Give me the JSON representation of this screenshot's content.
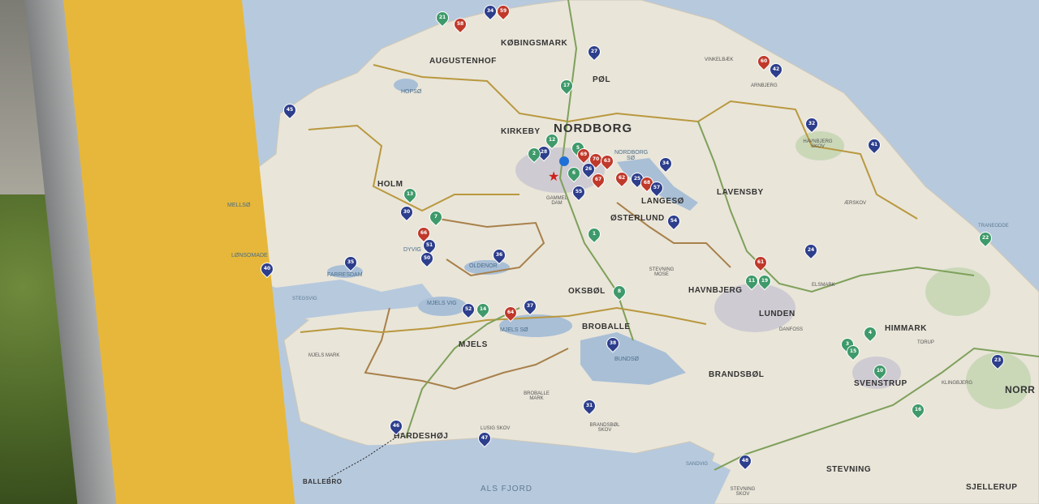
{
  "towns_major": [
    {
      "id": "nordborg",
      "label": "NORDBORG"
    }
  ],
  "towns": [
    {
      "id": "kobingsmark",
      "label": "KØBINGSMARK"
    },
    {
      "id": "augustenhof",
      "label": "AUGUSTENHOF"
    },
    {
      "id": "pol",
      "label": "PØL"
    },
    {
      "id": "kirkeby",
      "label": "KIRKEBY"
    },
    {
      "id": "holm",
      "label": "HOLM"
    },
    {
      "id": "langeso",
      "label": "LANGESØ"
    },
    {
      "id": "osterlund",
      "label": "ØSTERLUND"
    },
    {
      "id": "lavensby",
      "label": "LAVENSBY"
    },
    {
      "id": "havnbjerg",
      "label": "HAVNBJERG"
    },
    {
      "id": "oksbol",
      "label": "OKSBØL"
    },
    {
      "id": "lunden",
      "label": "LUNDEN"
    },
    {
      "id": "himmark",
      "label": "HIMMARK"
    },
    {
      "id": "broballe",
      "label": "BROBALLE"
    },
    {
      "id": "mjels",
      "label": "MJELS"
    },
    {
      "id": "brandsbol",
      "label": "BRANDSBØL"
    },
    {
      "id": "svenstrup",
      "label": "SVENSTRUP"
    },
    {
      "id": "hardeshoj",
      "label": "HARDESHØJ"
    },
    {
      "id": "stevning",
      "label": "STEVNING"
    },
    {
      "id": "sjellerup",
      "label": "SJELLERUP"
    },
    {
      "id": "norr",
      "label": "NORR"
    }
  ],
  "places_small": [
    {
      "id": "vinkelbaek",
      "label": "VINKELBÆK"
    },
    {
      "id": "arnbjerg",
      "label": "ARNBJERG"
    },
    {
      "id": "havnbjerg-skov",
      "label": "HAVNBJERG SKOV"
    },
    {
      "id": "aerskov",
      "label": "ÆRSKOV"
    },
    {
      "id": "gammel-dam",
      "label": "GAMMEL DAM"
    },
    {
      "id": "stevning-mose",
      "label": "STEVNING MOSE"
    },
    {
      "id": "elsmark",
      "label": "ELSMARK"
    },
    {
      "id": "danfoss",
      "label": "DANFOSS"
    },
    {
      "id": "torup",
      "label": "TORUP"
    },
    {
      "id": "klingbjerg",
      "label": "KLINGBJERG"
    },
    {
      "id": "mjels-mark",
      "label": "MJELS MARK"
    },
    {
      "id": "broballe-mark",
      "label": "BROBALLE MARK"
    },
    {
      "id": "brandsbol-skov",
      "label": "BRANDSBØL SKOV"
    },
    {
      "id": "lusig-skov",
      "label": "LUSIG SKOV"
    },
    {
      "id": "stevning-skov",
      "label": "STEVNING SKOV"
    },
    {
      "id": "ballebro",
      "label": "BALLEBRO"
    }
  ],
  "waters": [
    {
      "id": "hopso",
      "label": "HOPSØ"
    },
    {
      "id": "nordborg-so",
      "label": "NORDBORG SØ"
    },
    {
      "id": "mellso",
      "label": "MELLSØ"
    },
    {
      "id": "lonsomade",
      "label": "LØNSOMADE"
    },
    {
      "id": "farresdam",
      "label": "FARRESDAM"
    },
    {
      "id": "dyvig",
      "label": "DYVIG"
    },
    {
      "id": "oldenor",
      "label": "OLDENOR"
    },
    {
      "id": "mjels-vig",
      "label": "MJELS VIG"
    },
    {
      "id": "mjels-so",
      "label": "MJELS SØ"
    },
    {
      "id": "bundso",
      "label": "BUNDSØ"
    },
    {
      "id": "stegsvig",
      "label": "STEGSVIG"
    },
    {
      "id": "sandvig",
      "label": "SANDVIG"
    },
    {
      "id": "tranedde",
      "label": "TRANEODDE"
    }
  ],
  "sea_label": "ALS FJORD",
  "marker_colors": {
    "blue": "#2d3e8c",
    "red": "#c0392b",
    "green": "#3e9a6a"
  },
  "markers": [
    {
      "n": "21",
      "c": "green"
    },
    {
      "n": "58",
      "c": "red"
    },
    {
      "n": "34",
      "c": "blue"
    },
    {
      "n": "59",
      "c": "red"
    },
    {
      "n": "27",
      "c": "blue"
    },
    {
      "n": "17",
      "c": "green"
    },
    {
      "n": "60",
      "c": "red"
    },
    {
      "n": "42",
      "c": "blue"
    },
    {
      "n": "45",
      "c": "blue"
    },
    {
      "n": "32",
      "c": "blue"
    },
    {
      "n": "41",
      "c": "blue"
    },
    {
      "n": "12",
      "c": "green"
    },
    {
      "n": "28",
      "c": "blue"
    },
    {
      "n": "2",
      "c": "green"
    },
    {
      "n": "5",
      "c": "green"
    },
    {
      "n": "69",
      "c": "red"
    },
    {
      "n": "70",
      "c": "red"
    },
    {
      "n": "63",
      "c": "red"
    },
    {
      "n": "26",
      "c": "blue"
    },
    {
      "n": "6",
      "c": "green"
    },
    {
      "n": "67",
      "c": "red"
    },
    {
      "n": "62",
      "c": "red"
    },
    {
      "n": "25",
      "c": "blue"
    },
    {
      "n": "68",
      "c": "red"
    },
    {
      "n": "57",
      "c": "blue"
    },
    {
      "n": "34",
      "c": "blue"
    },
    {
      "n": "55",
      "c": "blue"
    },
    {
      "n": "13",
      "c": "green"
    },
    {
      "n": "30",
      "c": "blue"
    },
    {
      "n": "7",
      "c": "green"
    },
    {
      "n": "54",
      "c": "blue"
    },
    {
      "n": "1",
      "c": "green"
    },
    {
      "n": "66",
      "c": "red"
    },
    {
      "n": "51",
      "c": "blue"
    },
    {
      "n": "50",
      "c": "blue"
    },
    {
      "n": "36",
      "c": "blue"
    },
    {
      "n": "35",
      "c": "blue"
    },
    {
      "n": "40",
      "c": "blue"
    },
    {
      "n": "22",
      "c": "green"
    },
    {
      "n": "24",
      "c": "blue"
    },
    {
      "n": "61",
      "c": "red"
    },
    {
      "n": "11",
      "c": "green"
    },
    {
      "n": "19",
      "c": "green"
    },
    {
      "n": "8",
      "c": "green"
    },
    {
      "n": "52",
      "c": "blue"
    },
    {
      "n": "14",
      "c": "green"
    },
    {
      "n": "64",
      "c": "red"
    },
    {
      "n": "37",
      "c": "blue"
    },
    {
      "n": "38",
      "c": "blue"
    },
    {
      "n": "4",
      "c": "green"
    },
    {
      "n": "3",
      "c": "green"
    },
    {
      "n": "15",
      "c": "green"
    },
    {
      "n": "10",
      "c": "green"
    },
    {
      "n": "23",
      "c": "blue"
    },
    {
      "n": "31",
      "c": "blue"
    },
    {
      "n": "16",
      "c": "green"
    },
    {
      "n": "46",
      "c": "blue"
    },
    {
      "n": "47",
      "c": "blue"
    },
    {
      "n": "48",
      "c": "blue"
    }
  ]
}
